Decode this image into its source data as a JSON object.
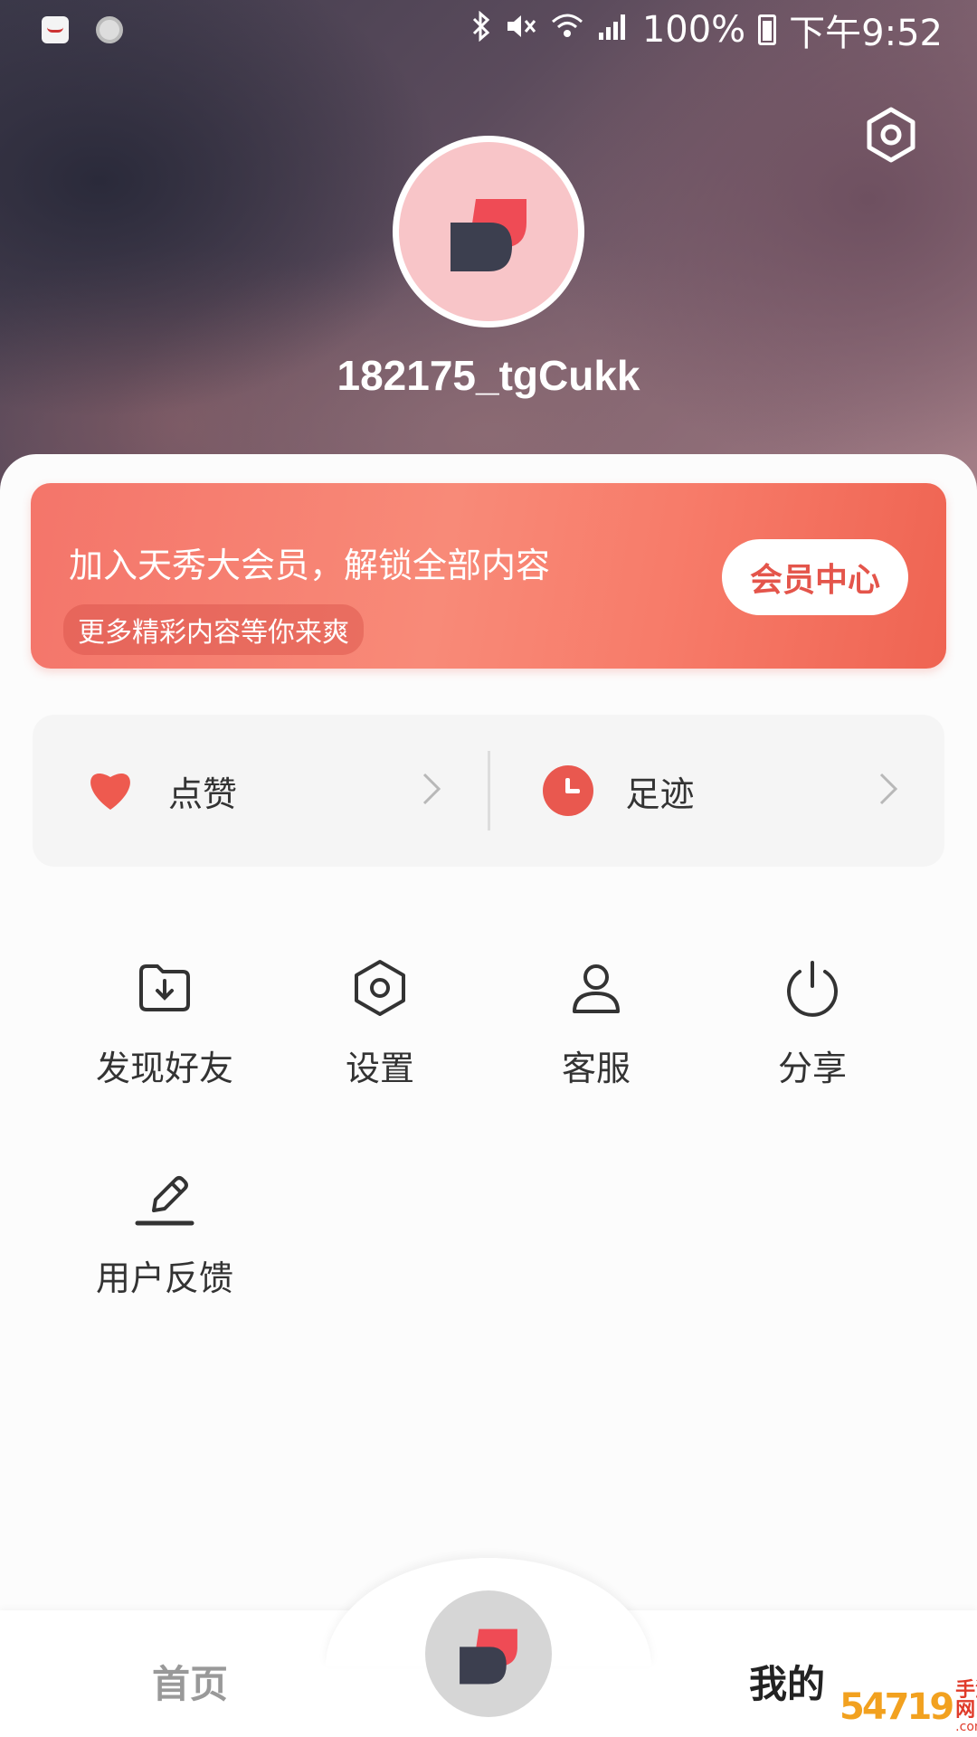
{
  "status_bar": {
    "battery": "100%",
    "time": "下午9:52",
    "icons": [
      "huawei-app-icon",
      "notification-dot-icon",
      "bluetooth-icon",
      "mute-icon",
      "wifi-icon",
      "signal-icon",
      "battery-charging-icon"
    ]
  },
  "profile": {
    "username": "182175_tgCukk",
    "avatar": "app-logo-avatar"
  },
  "vip": {
    "title": "加入天秀大会员，解锁全部内容",
    "subtitle": "更多精彩内容等你来爽",
    "button": "会员中心"
  },
  "quick": {
    "likes": "点赞",
    "history": "足迹"
  },
  "grid": [
    {
      "label": "发现好友",
      "icon": "folder-download-icon"
    },
    {
      "label": "设置",
      "icon": "settings-hex-icon"
    },
    {
      "label": "客服",
      "icon": "user-icon"
    },
    {
      "label": "分享",
      "icon": "power-icon"
    },
    {
      "label": "用户反馈",
      "icon": "pencil-icon"
    }
  ],
  "nav": {
    "home": "首页",
    "mine": "我的"
  },
  "watermark": {
    "number": "54719",
    "text": "手游网",
    "domain": ".com.cn"
  },
  "colors": {
    "accent": "#e9584f",
    "vip_gradient_start": "#f4756a",
    "vip_gradient_end": "#ef6452",
    "avatar_bg": "#f8c5c8"
  }
}
